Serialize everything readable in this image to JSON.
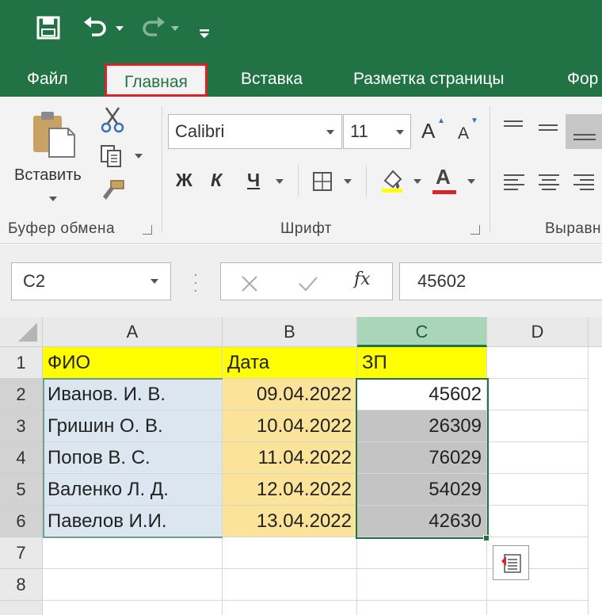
{
  "quick_access": {
    "save_icon": "save-icon",
    "undo_icon": "undo-icon",
    "redo_icon": "redo-icon",
    "customize_icon": "customize-qat-icon"
  },
  "tabs": [
    {
      "label": "Файл"
    },
    {
      "label": "Главная"
    },
    {
      "label": "Вставка"
    },
    {
      "label": "Разметка страницы"
    },
    {
      "label": "Фор"
    }
  ],
  "ribbon": {
    "clipboard": {
      "paste_label": "Вставить",
      "group_label": "Буфер обмена"
    },
    "font": {
      "font_name": "Calibri",
      "font_size": "11",
      "grow_label": "A",
      "shrink_label": "A",
      "bold_label": "Ж",
      "italic_label": "К",
      "underline_label": "Ч",
      "font_color_label": "A",
      "group_label": "Шрифт"
    },
    "alignment": {
      "group_label": "Выравн"
    }
  },
  "formula_bar": {
    "name_box": "C2",
    "fx_label": "fx",
    "value": "45602"
  },
  "sheet": {
    "columns": [
      "A",
      "B",
      "C",
      "D"
    ],
    "rows": [
      "1",
      "2",
      "3",
      "4",
      "5",
      "6",
      "7",
      "8"
    ],
    "header": [
      "ФИО",
      "Дата",
      "ЗП"
    ],
    "data": [
      [
        "Иванов. И. В.",
        "09.04.2022",
        "45602"
      ],
      [
        "Гришин О. В.",
        "10.04.2022",
        "26309"
      ],
      [
        "Попов В. С.",
        "11.04.2022",
        "76029"
      ],
      [
        "Валенко Л. Д.",
        "12.04.2022",
        "54029"
      ],
      [
        "Павелов И.И.",
        "13.04.2022",
        "42630"
      ]
    ],
    "selected_cell": "C2"
  },
  "colors": {
    "excel_green": "#217346",
    "highlight_yellow": "#ffff00",
    "name_fill": "#dbe6f1",
    "date_fill": "#fce39a",
    "selection_fill": "#c4c4c4",
    "tab_highlight": "#d8232a"
  }
}
